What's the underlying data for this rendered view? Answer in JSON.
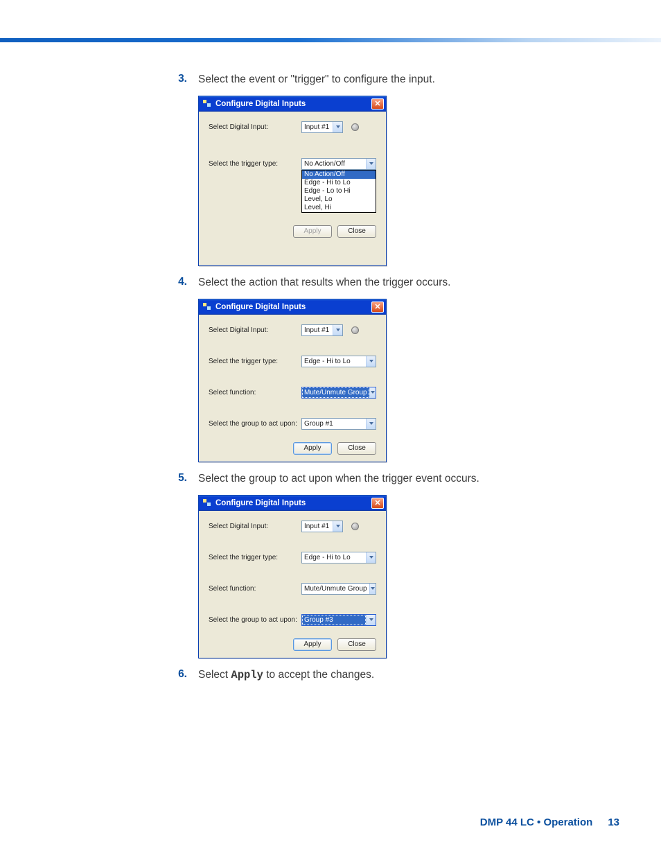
{
  "steps": {
    "s3": {
      "num": "3.",
      "text": "Select the event or \"trigger\" to configure the input."
    },
    "s4": {
      "num": "4.",
      "text": "Select the action that results when the trigger occurs."
    },
    "s5": {
      "num": "5.",
      "text": "Select the group to act upon when the trigger event occurs."
    },
    "s6": {
      "num": "6.",
      "text_pre": "Select ",
      "text_bold": "Apply",
      "text_post": " to accept the changes."
    }
  },
  "dialog": {
    "title": "Configure Digital Inputs",
    "labels": {
      "select_input": "Select Digital Input:",
      "select_trigger": "Select the trigger type:",
      "select_function": "Select function:",
      "select_group": "Select the group to act upon:"
    },
    "buttons": {
      "apply": "Apply",
      "close": "Close"
    }
  },
  "d1": {
    "input_value": "Input #1",
    "trigger_value": "No Action/Off",
    "trigger_options": [
      "No Action/Off",
      "Edge - Hi to Lo",
      "Edge - Lo to Hi",
      "Level, Lo",
      "Level, Hi"
    ]
  },
  "d2": {
    "input_value": "Input #1",
    "trigger_value": "Edge - Hi to Lo",
    "function_value": "Mute/Unmute Group",
    "group_value": "Group #1"
  },
  "d3": {
    "input_value": "Input #1",
    "trigger_value": "Edge - Hi to Lo",
    "function_value": "Mute/Unmute Group",
    "group_value": "Group #3"
  },
  "footer": {
    "text": "DMP 44 LC • Operation",
    "page": "13"
  }
}
